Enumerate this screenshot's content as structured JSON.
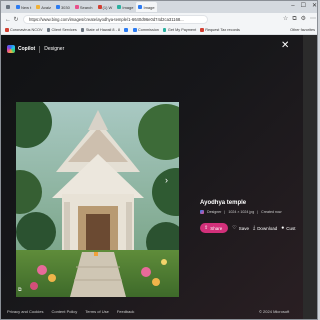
{
  "browser": {
    "tabs": [
      {
        "label": "",
        "color": "#6b7580"
      },
      {
        "label": "New t",
        "color": "#2b7bf2"
      },
      {
        "label": "Avaiz",
        "color": "#f2b134"
      },
      {
        "label": "3030",
        "color": "#2b7bf2"
      },
      {
        "label": "Search",
        "color": "#e94f8c"
      },
      {
        "label": "(1) W",
        "color": "#d23f31"
      },
      {
        "label": "Image",
        "color": "#2ab0a0"
      },
      {
        "label": "Image",
        "color": "#2b7bf2"
      }
    ],
    "url": "https://www.bing.com/images/create/ayodhya-temple/1-6640d96e0d74d2ca31168...",
    "bookmarks": [
      {
        "label": "Coronavirus NCOV",
        "color": "#d23f31"
      },
      {
        "label": "Client Services",
        "color": "#6b7580"
      },
      {
        "label": "State of Hawaii 8 - 8",
        "color": "#6b7580"
      },
      {
        "label": "",
        "color": "#2b7bf2"
      },
      {
        "label": "Commission",
        "color": "#2b7bf2"
      },
      {
        "label": "Get My Payment",
        "color": "#2ab0a0"
      },
      {
        "label": "Request Tax records",
        "color": "#d23f31"
      }
    ],
    "bookmarks_more": "Other favorites"
  },
  "modal": {
    "brand_name": "Copilot",
    "brand_sub": "Designer",
    "close_icon": "close-icon",
    "image_title": "Ayodhya temple",
    "meta_source": "Designer",
    "meta_size": "1024 × 1024 jpg",
    "meta_created": "Created now",
    "actions": {
      "share": "Share",
      "save": "Save",
      "download": "Download",
      "more": "Cust"
    }
  },
  "footer": {
    "links": [
      "Privacy and Cookies",
      "Content Policy",
      "Terms of Use",
      "Feedback"
    ],
    "copyright": "© 2024 Microsoft"
  },
  "colors": {
    "accent": "#d2307a",
    "background": "#141416"
  }
}
